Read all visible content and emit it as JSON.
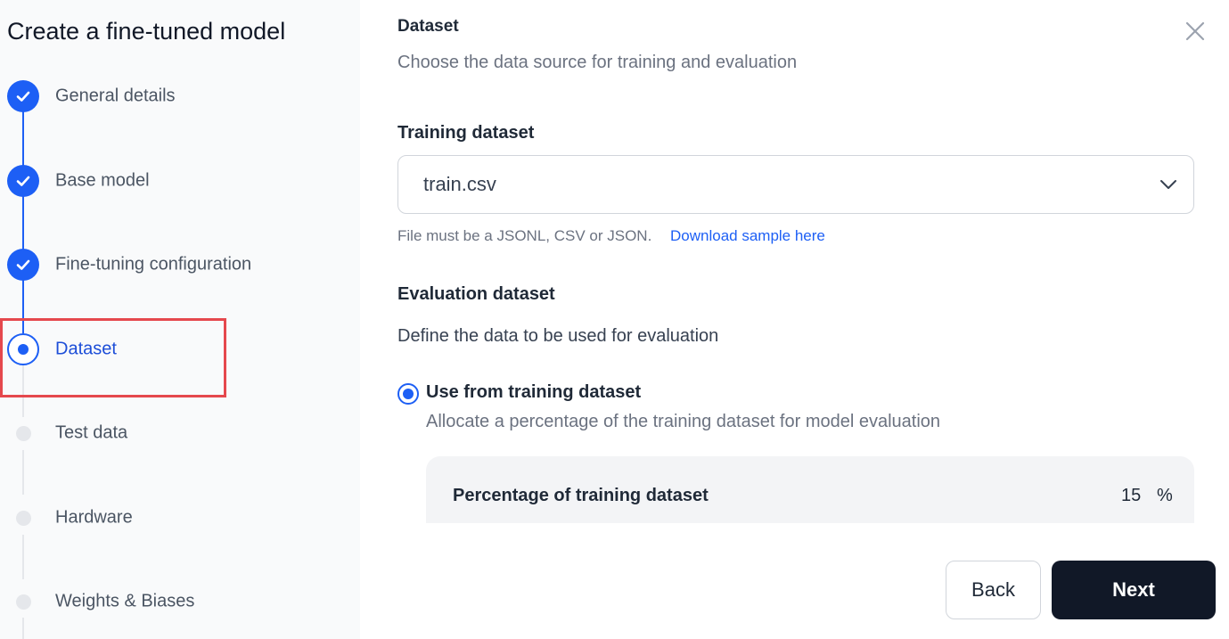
{
  "sidebar": {
    "title": "Create a fine-tuned model",
    "steps": [
      {
        "label": "General details",
        "state": "done"
      },
      {
        "label": "Base model",
        "state": "done"
      },
      {
        "label": "Fine-tuning configuration",
        "state": "done"
      },
      {
        "label": "Dataset",
        "state": "current"
      },
      {
        "label": "Test data",
        "state": "pending"
      },
      {
        "label": "Hardware",
        "state": "pending"
      },
      {
        "label": "Weights & Biases",
        "state": "pending"
      }
    ]
  },
  "main": {
    "heading": "Dataset",
    "subheading": "Choose the data source for training and evaluation",
    "training": {
      "label": "Training dataset",
      "selected_value": "train.csv",
      "helper_text": "File must be a JSONL, CSV or JSON.",
      "helper_link": "Download sample here"
    },
    "evaluation": {
      "label": "Evaluation dataset",
      "description": "Define the data to be used for evaluation",
      "option_label": "Use from training dataset",
      "option_description": "Allocate a percentage of the training dataset for model evaluation",
      "option_selected": true,
      "percentage_label": "Percentage of training dataset",
      "percentage_value": "15",
      "percentage_unit": "%"
    }
  },
  "footer": {
    "back_label": "Back",
    "next_label": "Next"
  },
  "colors": {
    "accent": "#1d5ff5",
    "primary_button": "#111827",
    "highlight": "#e5484d"
  },
  "icons": {
    "close": "close-icon",
    "chevron": "chevron-down-icon",
    "done": "check-icon"
  }
}
